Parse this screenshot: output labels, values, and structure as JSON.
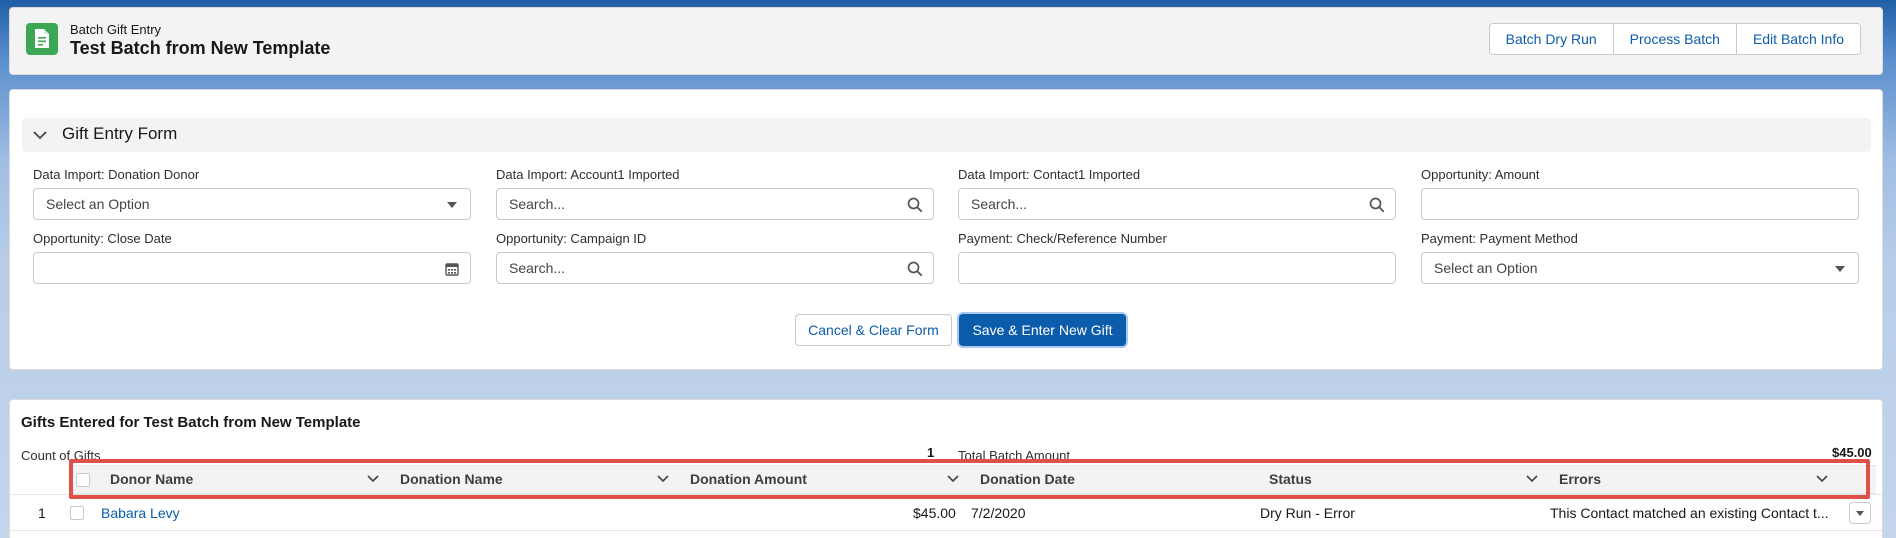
{
  "header": {
    "eyebrow": "Batch Gift Entry",
    "title": "Test Batch from New Template",
    "icon": "document-icon",
    "buttons": [
      "Batch Dry Run",
      "Process Batch",
      "Edit Batch Info"
    ]
  },
  "form": {
    "section_title": "Gift Entry Form",
    "fields": [
      {
        "label": "Data Import: Donation Donor",
        "value": "Select an Option",
        "type": "select"
      },
      {
        "label": "Data Import: Account1 Imported",
        "placeholder": "Search...",
        "type": "lookup"
      },
      {
        "label": "Data Import: Contact1 Imported",
        "placeholder": "Search...",
        "type": "lookup"
      },
      {
        "label": "Opportunity: Amount",
        "value": "",
        "type": "text"
      },
      {
        "label": "Opportunity: Close Date",
        "value": "",
        "type": "date"
      },
      {
        "label": "Opportunity: Campaign ID",
        "placeholder": "Search...",
        "type": "lookup"
      },
      {
        "label": "Payment: Check/Reference Number",
        "value": "",
        "type": "text"
      },
      {
        "label": "Payment: Payment Method",
        "value": "Select an Option",
        "type": "select"
      }
    ],
    "cancel_label": "Cancel & Clear Form",
    "save_label": "Save & Enter New Gift"
  },
  "gifts": {
    "title": "Gifts Entered for Test Batch from New Template",
    "count_label": "Count of Gifts",
    "count_value": "1",
    "total_label": "Total Batch Amount",
    "total_value": "$45.00",
    "columns": [
      "Donor Name",
      "Donation Name",
      "Donation Amount",
      "Donation Date",
      "Status",
      "Errors"
    ],
    "rows": [
      {
        "index": "1",
        "donor": "Babara Levy",
        "donation_name": "",
        "amount": "$45.00",
        "date": "7/2/2020",
        "status": "Dry Run - Error",
        "errors": "This Contact matched an existing Contact t..."
      }
    ]
  },
  "colors": {
    "brand": "#0b5cab",
    "app_icon": "#3ba755",
    "highlight": "#e0504a"
  }
}
